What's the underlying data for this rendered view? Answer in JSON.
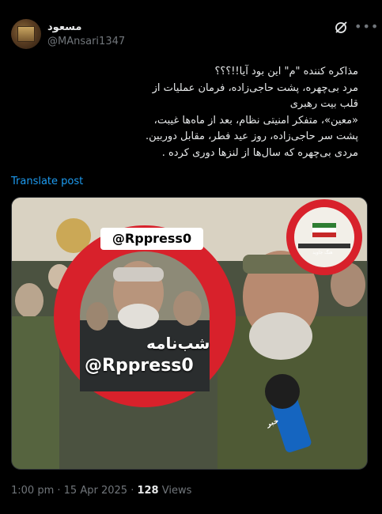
{
  "post": {
    "author": {
      "display_name": "مسعود",
      "handle": "@MAnsari1347"
    },
    "lines": [
      "مذاکره کننده \"م\" این بود آیا!!؟؟؟",
      "مرد بی‌چهره، پشت حاجی‌زاده، فرمان عملیات از",
      "قلب بیت رهبری",
      "«معین»، متفکر امنیتی نظام، بعد از ماه‌ها غیبت،",
      "پشت سر حاجی‌زاده، روز عید فطر، مقابل دوربین.",
      "مردی بی‌چهره که سال‌ها از لنزها دوری کرده ."
    ],
    "translate_label": "Translate post",
    "media": {
      "watermark_top": "@Rppress0",
      "watermark_fa": "شب‌نامه",
      "watermark_handle": "@Rppress0",
      "badge_text": "هنگ جاوید",
      "mic_text": "خبر"
    },
    "time": "1:00 pm",
    "date": "15 Apr 2025",
    "views_count": "128",
    "views_label": "Views"
  },
  "icons": {
    "grok": "grok-icon",
    "more": "more-icon"
  },
  "colors": {
    "background": "#000000",
    "text": "#e7e9ea",
    "muted": "#71767b",
    "link": "#1d9bf0",
    "ring_red": "#d8212b"
  }
}
